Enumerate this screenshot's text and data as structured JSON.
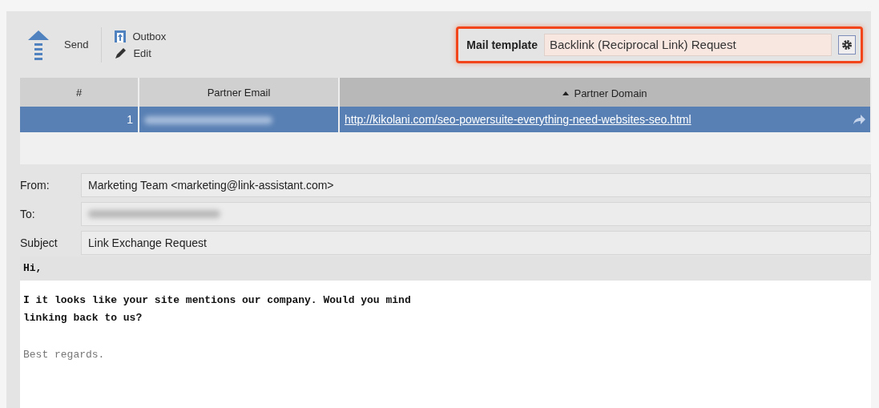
{
  "toolbar": {
    "buttons": [
      {
        "label": "Send",
        "kind": "send"
      },
      {
        "label": "Outbox",
        "kind": "outbox"
      },
      {
        "label": "Edit",
        "kind": "edit"
      }
    ]
  },
  "mail_template": {
    "label": "Mail template",
    "value": "Backlink (Reciprocal Link) Request",
    "highlighted": true
  },
  "table": {
    "columns": [
      {
        "label": "#",
        "sorted": false
      },
      {
        "label": "Partner Email",
        "sorted": false
      },
      {
        "label": "Partner Domain",
        "sorted": true
      }
    ],
    "rows": [
      {
        "number": "1",
        "email_blurred": true,
        "domain": "http://kikolani.com/seo-powersuite-everything-need-websites-seo.html",
        "selected": true
      }
    ]
  },
  "form": {
    "fields": [
      {
        "label": "From:",
        "value": "Marketing Team <marketing@link-assistant.com>",
        "blurred": false
      },
      {
        "label": "To:",
        "blurred": true
      },
      {
        "label": "Subject",
        "value": "Link Exchange Request",
        "blurred": false
      }
    ]
  },
  "body": {
    "paragraphs": [
      {
        "kind": "greeting",
        "text": "Hi,"
      },
      {
        "kind": "text",
        "text": "I it looks like your site mentions our company. Would you mind\nlinking back to us?"
      },
      {
        "kind": "signature",
        "text": "Best regards."
      }
    ]
  }
}
